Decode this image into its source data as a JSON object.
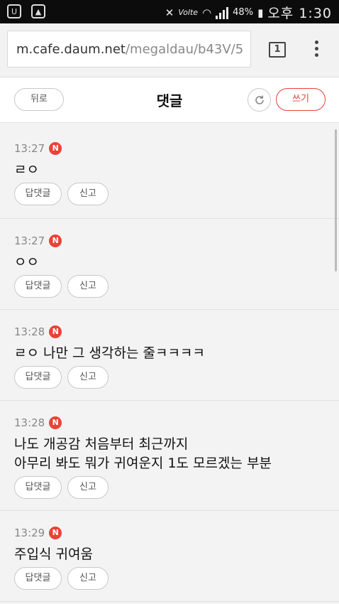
{
  "statusbar": {
    "carrier_label": "Volte",
    "battery": "48%",
    "time": "오후 1:30"
  },
  "browser": {
    "url_host": "m.cafe.daum.net",
    "url_path": "/megaldau/b43V/5",
    "tab_count": "1"
  },
  "header": {
    "back_label": "뒤로",
    "title": "댓글",
    "write_label": "쓰기"
  },
  "comments": [
    {
      "time": "13:27",
      "badge": "N",
      "text": "ㄹㅇ",
      "reply_label": "답댓글",
      "report_label": "신고"
    },
    {
      "time": "13:27",
      "badge": "N",
      "text": "ㅇㅇ",
      "reply_label": "답댓글",
      "report_label": "신고"
    },
    {
      "time": "13:28",
      "badge": "N",
      "text": "ㄹㅇ 나만 그 생각하는 줄ㅋㅋㅋㅋ",
      "reply_label": "답댓글",
      "report_label": "신고"
    },
    {
      "time": "13:28",
      "badge": "N",
      "text": "나도 개공감 처음부터 최근까지\n아무리 봐도 뭐가 귀여운지 1도 모르겠는 부분",
      "reply_label": "답댓글",
      "report_label": "신고"
    },
    {
      "time": "13:29",
      "badge": "N",
      "text": "주입식 귀여움",
      "reply_label": "답댓글",
      "report_label": "신고"
    }
  ]
}
